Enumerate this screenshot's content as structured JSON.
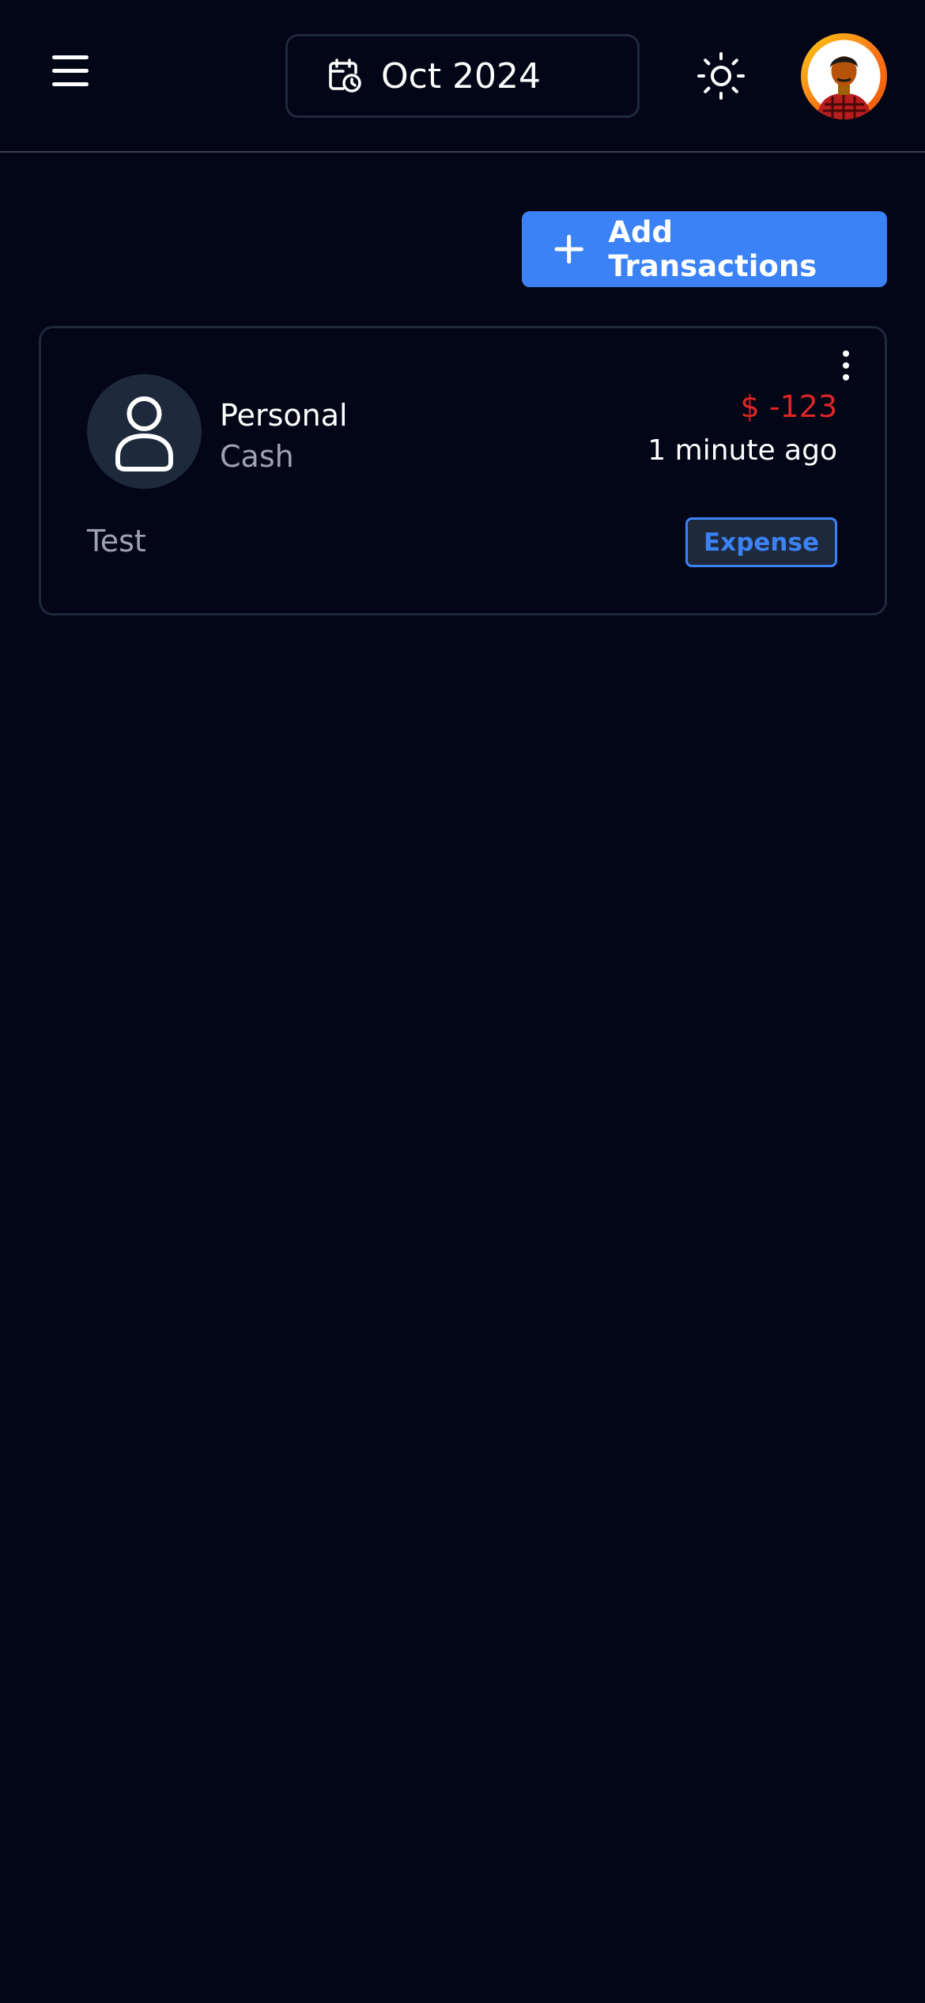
{
  "header": {
    "date_label": "Oct 2024"
  },
  "actions": {
    "add_label": "Add Transactions"
  },
  "transactions": [
    {
      "category": "Personal",
      "account": "Cash",
      "amount": "$ -123",
      "time": "1 minute ago",
      "note": "Test",
      "type": "Expense"
    }
  ],
  "colors": {
    "background": "#020617",
    "accent": "#3b82f6",
    "expense": "#dc2626",
    "muted_text": "#9ca3af",
    "border": "#1e293b"
  },
  "icons": {
    "menu": "menu-icon",
    "calendar": "calendar-clock-icon",
    "theme": "sun-icon",
    "add": "plus-icon",
    "more": "more-vertical-icon",
    "category": "user-icon"
  }
}
